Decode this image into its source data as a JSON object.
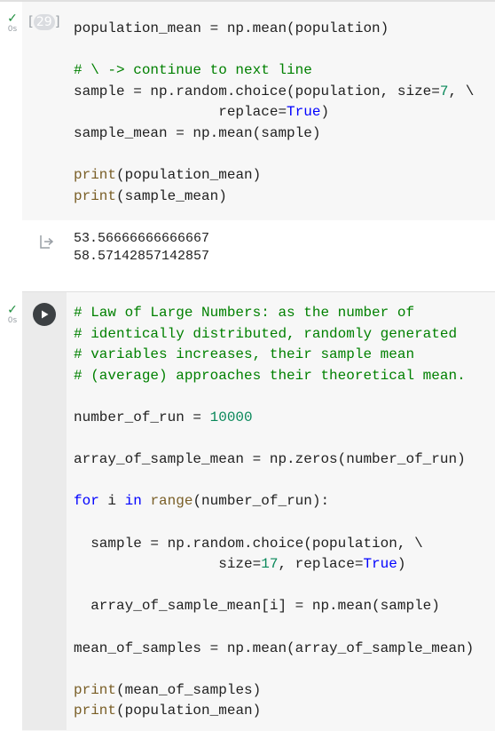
{
  "cell1": {
    "status": "✓",
    "exec_time": "0s",
    "exec_count": "29",
    "code_lines": [
      [
        {
          "t": "population_mean = np.mean(population)",
          "c": "default"
        }
      ],
      [],
      [
        {
          "t": "# \\ -> continue to next line",
          "c": "comment"
        }
      ],
      [
        {
          "t": "sample = np.random.choice(population, size=",
          "c": "default"
        },
        {
          "t": "7",
          "c": "number"
        },
        {
          "t": ", \\",
          "c": "default"
        }
      ],
      [
        {
          "t": "                 replace=",
          "c": "default"
        },
        {
          "t": "True",
          "c": "keyword"
        },
        {
          "t": ")",
          "c": "default"
        }
      ],
      [
        {
          "t": "sample_mean = np.mean(sample)",
          "c": "default"
        }
      ],
      [],
      [
        {
          "t": "print",
          "c": "builtin"
        },
        {
          "t": "(population_mean)",
          "c": "default"
        }
      ],
      [
        {
          "t": "print",
          "c": "builtin"
        },
        {
          "t": "(sample_mean)",
          "c": "default"
        }
      ]
    ]
  },
  "output1": {
    "lines": [
      "53.56666666666667",
      "58.57142857142857"
    ]
  },
  "cell2": {
    "status": "✓",
    "exec_time": "0s",
    "code_lines": [
      [
        {
          "t": "# Law of Large Numbers: as the number of",
          "c": "comment"
        }
      ],
      [
        {
          "t": "# identically distributed, randomly generated",
          "c": "comment"
        }
      ],
      [
        {
          "t": "# variables increases, their sample mean",
          "c": "comment"
        }
      ],
      [
        {
          "t": "# (average) approaches their theoretical mean.",
          "c": "comment"
        }
      ],
      [],
      [
        {
          "t": "number_of_run = ",
          "c": "default"
        },
        {
          "t": "10000",
          "c": "number"
        }
      ],
      [],
      [
        {
          "t": "array_of_sample_mean = np.zeros(number_of_run)",
          "c": "default"
        }
      ],
      [],
      [
        {
          "t": "for",
          "c": "keyword"
        },
        {
          "t": " i ",
          "c": "default"
        },
        {
          "t": "in",
          "c": "keyword"
        },
        {
          "t": " ",
          "c": "default"
        },
        {
          "t": "range",
          "c": "builtin"
        },
        {
          "t": "(number_of_run):",
          "c": "default"
        }
      ],
      [],
      [
        {
          "t": "  sample = np.random.choice(population, \\",
          "c": "default"
        }
      ],
      [
        {
          "t": "                 size=",
          "c": "default"
        },
        {
          "t": "17",
          "c": "number"
        },
        {
          "t": ", replace=",
          "c": "default"
        },
        {
          "t": "True",
          "c": "keyword"
        },
        {
          "t": ")",
          "c": "default"
        }
      ],
      [],
      [
        {
          "t": "  array_of_sample_mean[i] = np.mean(sample)",
          "c": "default"
        }
      ],
      [],
      [
        {
          "t": "mean_of_samples = np.mean(array_of_sample_mean)",
          "c": "default"
        }
      ],
      [],
      [
        {
          "t": "print",
          "c": "builtin"
        },
        {
          "t": "(mean_of_samples)",
          "c": "default"
        }
      ],
      [
        {
          "t": "print",
          "c": "builtin"
        },
        {
          "t": "(population_mean)",
          "c": "default"
        }
      ]
    ]
  },
  "icons": {
    "status": "check-icon",
    "output": "output-arrow-icon",
    "run": "play-icon"
  },
  "colors": {
    "comment": "#008000",
    "number": "#09885a",
    "keyword": "#0000ff",
    "builtin": "#795e26",
    "check": "#1e8e3e"
  }
}
